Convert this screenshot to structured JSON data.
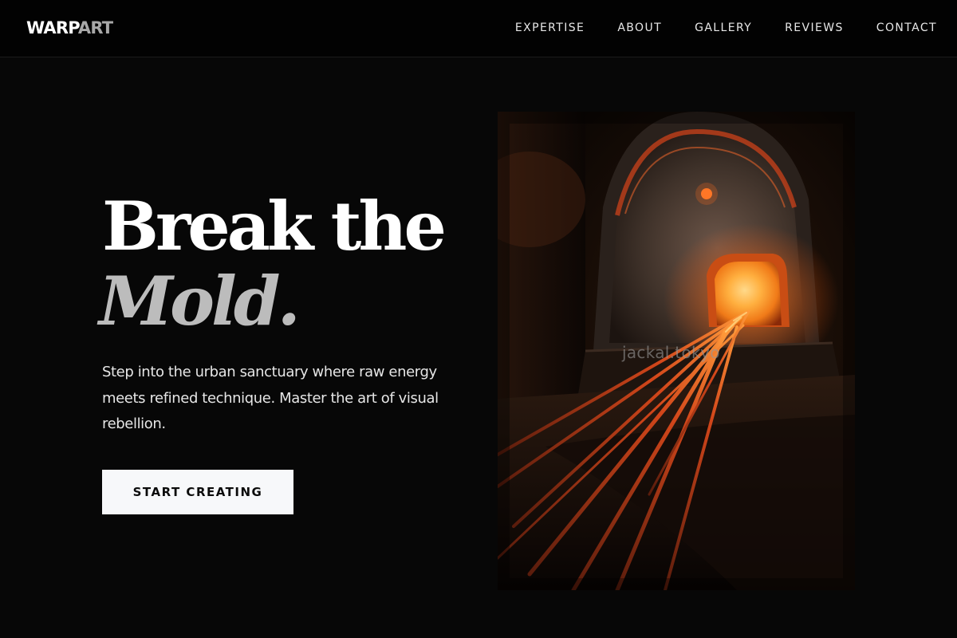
{
  "header": {
    "logo_primary": "WARP",
    "logo_accent": "ART",
    "nav": [
      "EXPERTISE",
      "ABOUT",
      "GALLERY",
      "REVIEWS",
      "CONTACT"
    ]
  },
  "hero": {
    "title_line1": "Break the",
    "title_line2": "Mold.",
    "description": "Step into the urban sanctuary where raw energy meets refined technique. Master the art of visual rebellion.",
    "cta_label": "START CREATING",
    "image_caption": "jackal.tokyo"
  },
  "colors": {
    "background": "#070707",
    "header_background": "#020202",
    "text_primary": "#ffffff",
    "text_muted": "#bcbcbc",
    "button_background": "#f7f8fa",
    "glow": "#ff8a1e"
  }
}
